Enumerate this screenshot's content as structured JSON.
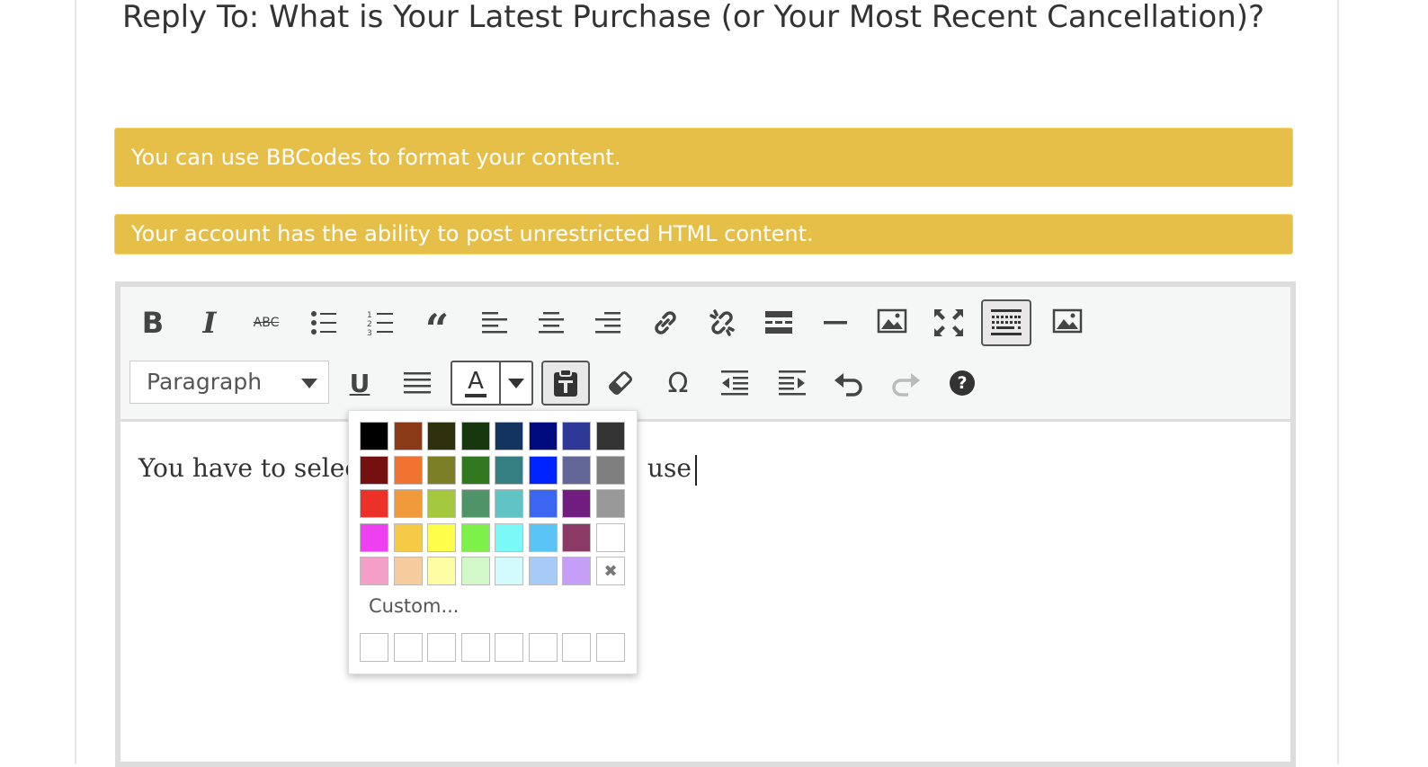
{
  "page": {
    "title": "Reply To: What is Your Latest Purchase (or Your Most Recent Cancellation)?"
  },
  "notices": {
    "bbcodes": "You can use BBCodes to format your content.",
    "html": "Your account has the ability to post unrestricted HTML content."
  },
  "toolbar": {
    "row1": [
      {
        "name": "bold-button",
        "icon": "bold-icon"
      },
      {
        "name": "italic-button",
        "icon": "italic-icon"
      },
      {
        "name": "strikethrough-button",
        "icon": "strikethrough-icon",
        "glyph": "ABC"
      },
      {
        "name": "bullet-list-button",
        "icon": "bullet-list-icon"
      },
      {
        "name": "numbered-list-button",
        "icon": "numbered-list-icon"
      },
      {
        "name": "blockquote-button",
        "icon": "quote-icon"
      },
      {
        "name": "align-left-button",
        "icon": "align-left-icon"
      },
      {
        "name": "align-center-button",
        "icon": "align-center-icon"
      },
      {
        "name": "align-right-button",
        "icon": "align-right-icon"
      },
      {
        "name": "insert-link-button",
        "icon": "link-icon"
      },
      {
        "name": "remove-link-button",
        "icon": "unlink-icon"
      },
      {
        "name": "read-more-button",
        "icon": "read-more-icon"
      },
      {
        "name": "horizontal-line-button",
        "icon": "horizontal-line-icon"
      },
      {
        "name": "insert-image-button",
        "icon": "image-icon"
      },
      {
        "name": "fullscreen-button",
        "icon": "fullscreen-icon"
      },
      {
        "name": "toolbar-toggle-button",
        "icon": "keyboard-icon"
      },
      {
        "name": "insert-media-button",
        "icon": "image-icon"
      }
    ],
    "row2": {
      "format_select": "Paragraph",
      "buttons": [
        {
          "name": "underline-button",
          "icon": "underline-icon"
        },
        {
          "name": "justify-button",
          "icon": "justify-icon"
        },
        {
          "name": "text-color-button",
          "icon": "text-color-icon",
          "glyph": "A"
        },
        {
          "name": "paste-as-text-button",
          "icon": "paste-text-icon"
        },
        {
          "name": "clear-formatting-button",
          "icon": "eraser-icon"
        },
        {
          "name": "special-character-button",
          "icon": "omega-icon",
          "glyph": "Ω"
        },
        {
          "name": "outdent-button",
          "icon": "outdent-icon"
        },
        {
          "name": "indent-button",
          "icon": "indent-icon"
        },
        {
          "name": "undo-button",
          "icon": "undo-icon"
        },
        {
          "name": "redo-button",
          "icon": "redo-icon"
        },
        {
          "name": "help-button",
          "icon": "help-icon",
          "glyph": "?"
        }
      ]
    }
  },
  "editor": {
    "content_before": "You have to selec",
    "content_after": " use"
  },
  "color_picker": {
    "colors": [
      [
        "#000000",
        "#8b3a18",
        "#2f300e",
        "#17380f",
        "#12345f",
        "#000b80",
        "#2e3896",
        "#333333"
      ],
      [
        "#741010",
        "#ef7431",
        "#7d7f27",
        "#31781f",
        "#357f82",
        "#0024ff",
        "#636797",
        "#7f7f7f"
      ],
      [
        "#ec3128",
        "#f19a3b",
        "#a4c93f",
        "#4f9469",
        "#60c4c5",
        "#3b66f2",
        "#711d80",
        "#999999"
      ],
      [
        "#ec40f1",
        "#f5ca46",
        "#fdfd4a",
        "#7ef04a",
        "#7bf9f9",
        "#5ac4f6",
        "#8b3965",
        "#ffffff"
      ],
      [
        "#f39fc8",
        "#f6cc9e",
        "#fefda4",
        "#d2f8c8",
        "#d4fbfb",
        "#a6cbf7",
        "#c69df7",
        "remove"
      ]
    ],
    "remove_glyph": "✖",
    "custom_label": "Custom...",
    "custom_slots": 8
  }
}
